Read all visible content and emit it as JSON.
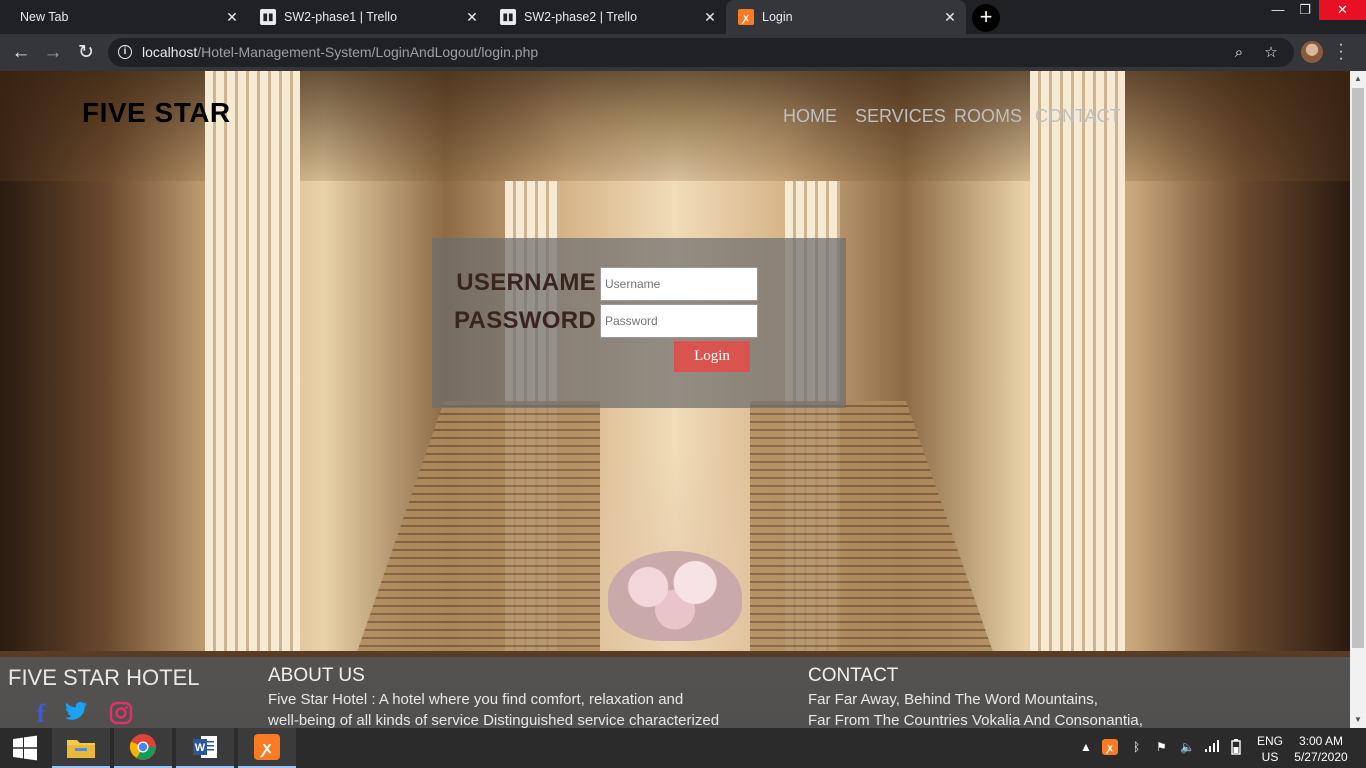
{
  "browser": {
    "tabs": [
      {
        "title": "New Tab",
        "icon": "chrome-newtab-icon",
        "active": false
      },
      {
        "title": "SW2-phase1 | Trello",
        "icon": "trello-icon",
        "active": false
      },
      {
        "title": "SW2-phase2 | Trello",
        "icon": "trello-icon",
        "active": false
      },
      {
        "title": "Login",
        "icon": "xampp-icon",
        "active": true
      }
    ],
    "close_glyph": "✕",
    "new_tab_glyph": "+",
    "url_host": "localhost",
    "url_path": "/Hotel-Management-System/LoginAndLogout/login.php",
    "window_controls": {
      "minimize": "—",
      "restore": "❐",
      "close": "✕"
    }
  },
  "site": {
    "brand": "FIVE STAR",
    "nav": [
      "HOME",
      "SERVICES",
      "ROOMS",
      "CONTACT"
    ],
    "login": {
      "username_label": "USERNAME",
      "password_label": "PASSWORD",
      "username_placeholder": "Username",
      "password_placeholder": "Password",
      "button": "Login",
      "button_color": "#d9534f"
    },
    "footer": {
      "title": "FIVE STAR HOTEL",
      "about_heading": "ABOUT US",
      "about_line1": "Five Star Hotel : A hotel where you find comfort, relaxation and",
      "about_line2": "well-being of all kinds of service Distinguished service characterized",
      "contact_heading": "CONTACT",
      "contact_line1": "Far Far Away, Behind The Word Mountains,",
      "contact_line2": "Far From The Countries Vokalia And Consonantia,",
      "social": [
        {
          "icon": "facebook-icon",
          "glyph": "f",
          "color": "#3b5bdb"
        },
        {
          "icon": "twitter-icon",
          "glyph": "🐦",
          "color": "#1da1f2"
        },
        {
          "icon": "instagram-icon",
          "glyph": "◎",
          "color": "#e1306c"
        }
      ]
    }
  },
  "taskbar": {
    "apps": [
      "windows-start-icon",
      "file-explorer-icon",
      "chrome-icon",
      "word-icon",
      "xampp-icon"
    ],
    "language_line1": "ENG",
    "language_line2": "US",
    "time": "3:00 AM",
    "date": "5/27/2020"
  }
}
